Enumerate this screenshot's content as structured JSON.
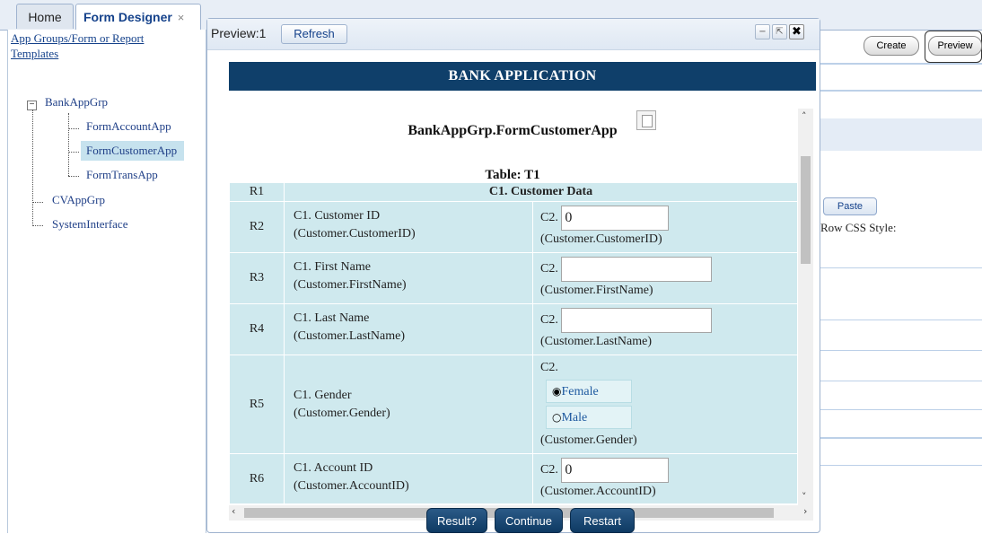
{
  "tabs": {
    "home": "Home",
    "form_designer": "Form Designer",
    "close_glyph": "×"
  },
  "tree": {
    "root_title": "App Groups/Form or Report Templates",
    "groups": [
      {
        "label": "BankAppGrp",
        "expanded": true,
        "children": [
          "FormAccountApp",
          "FormCustomerApp",
          "FormTransApp"
        ],
        "selected": "FormCustomerApp"
      },
      {
        "label": "CVAppGrp"
      },
      {
        "label": "SystemInterface"
      }
    ],
    "expand_glyph": "−"
  },
  "right": {
    "create_label": "Create",
    "preview_label": "Preview",
    "paste_label": "Paste",
    "row_css_label": "Row CSS Style:"
  },
  "dialog": {
    "title": "Preview:1",
    "refresh_label": "Refresh",
    "minimize_glyph": "−",
    "restore_glyph": "⇱",
    "close_glyph": "✖",
    "banner": "BANK APPLICATION",
    "form_title": "BankAppGrp.FormCustomerApp",
    "table_title": "Table: T1",
    "header_row": {
      "rno": "R1",
      "label": "C1. Customer Data"
    },
    "rows": [
      {
        "rno": "R2",
        "label1": "C1. Customer ID",
        "label2": "(Customer.CustomerID)",
        "val_prefix": "C2.",
        "value": "0",
        "bind": "(Customer.CustomerID)"
      },
      {
        "rno": "R3",
        "label1": "C1. First Name",
        "label2": "(Customer.FirstName)",
        "val_prefix": "C2.",
        "value": "",
        "bind": "(Customer.FirstName)"
      },
      {
        "rno": "R4",
        "label1": "C1. Last Name",
        "label2": "(Customer.LastName)",
        "val_prefix": "C2.",
        "value": "",
        "bind": "(Customer.LastName)"
      },
      {
        "rno": "R5",
        "label1": "C1. Gender",
        "label2": "(Customer.Gender)",
        "val_prefix": "C2.",
        "options": [
          "Female",
          "Male"
        ],
        "selected": "Female",
        "bind": "(Customer.Gender)"
      },
      {
        "rno": "R6",
        "label1": "C1. Account ID",
        "label2": "(Customer.AccountID)",
        "val_prefix": "C2.",
        "value": "0",
        "bind": "(Customer.AccountID)"
      }
    ],
    "radio_on": "◉",
    "radio_off": "○",
    "footer_buttons": {
      "result": "Result?",
      "continue": "Continue",
      "restart": "Restart"
    },
    "scroll_glyphs": {
      "up": "˄",
      "down": "˅",
      "left": "‹",
      "right": "›"
    }
  }
}
